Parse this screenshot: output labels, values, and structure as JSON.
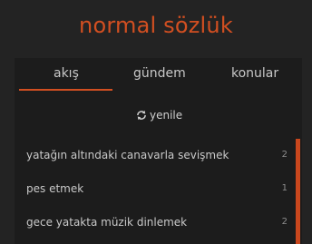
{
  "site": {
    "title": "normal sözlük"
  },
  "tabs": [
    {
      "label": "akış",
      "active": true
    },
    {
      "label": "gündem",
      "active": false
    },
    {
      "label": "konular",
      "active": false
    }
  ],
  "refresh": {
    "label": "yenile",
    "icon": "refresh-icon"
  },
  "entries": [
    {
      "title": "yatağın altındaki canavarla sevişmek",
      "count": "2"
    },
    {
      "title": "pes etmek",
      "count": "1"
    },
    {
      "title": "gece yatakta müzik dinlemek",
      "count": "2"
    }
  ],
  "colors": {
    "accent": "#d24f21",
    "background": "#232323",
    "panel": "#1c1c1c"
  }
}
